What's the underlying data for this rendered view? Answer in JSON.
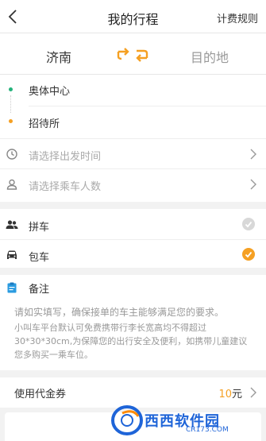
{
  "header": {
    "title": "我的行程",
    "rules_label": "计费规则"
  },
  "cities": {
    "from": "济南",
    "to": "目的地"
  },
  "stops": {
    "start": "奥体中心",
    "end": "招待所"
  },
  "options": {
    "time_placeholder": "请选择出发时间",
    "passenger_placeholder": "请选择乘车人数"
  },
  "ride_types": [
    {
      "label": "拼车",
      "selected": false
    },
    {
      "label": "包车",
      "selected": true
    }
  ],
  "remark": {
    "label": "备注",
    "hint_primary": "请如实填写，确保接单的车主能够满足您的要求。",
    "hint_secondary": "小叫车平台默认可免费携带行李长宽高均不得超过30*30*30cm,为保障您的出行安全及便利，如携带儿童建议您多购买一乘车位。"
  },
  "coupon": {
    "label": "使用代金券",
    "amount": "10",
    "unit": "元"
  },
  "watermark": {
    "text": "西西软件园",
    "url": "CR173.COM"
  },
  "colors": {
    "accent": "#f5a023",
    "green": "#24b27b",
    "placeholder": "#aaaaaa"
  },
  "icons": [
    "back-arrow-icon",
    "swap-icon",
    "clock-icon",
    "person-icon",
    "people-icon",
    "car-icon",
    "clipboard-icon",
    "chevron-right-icon",
    "check-icon"
  ]
}
